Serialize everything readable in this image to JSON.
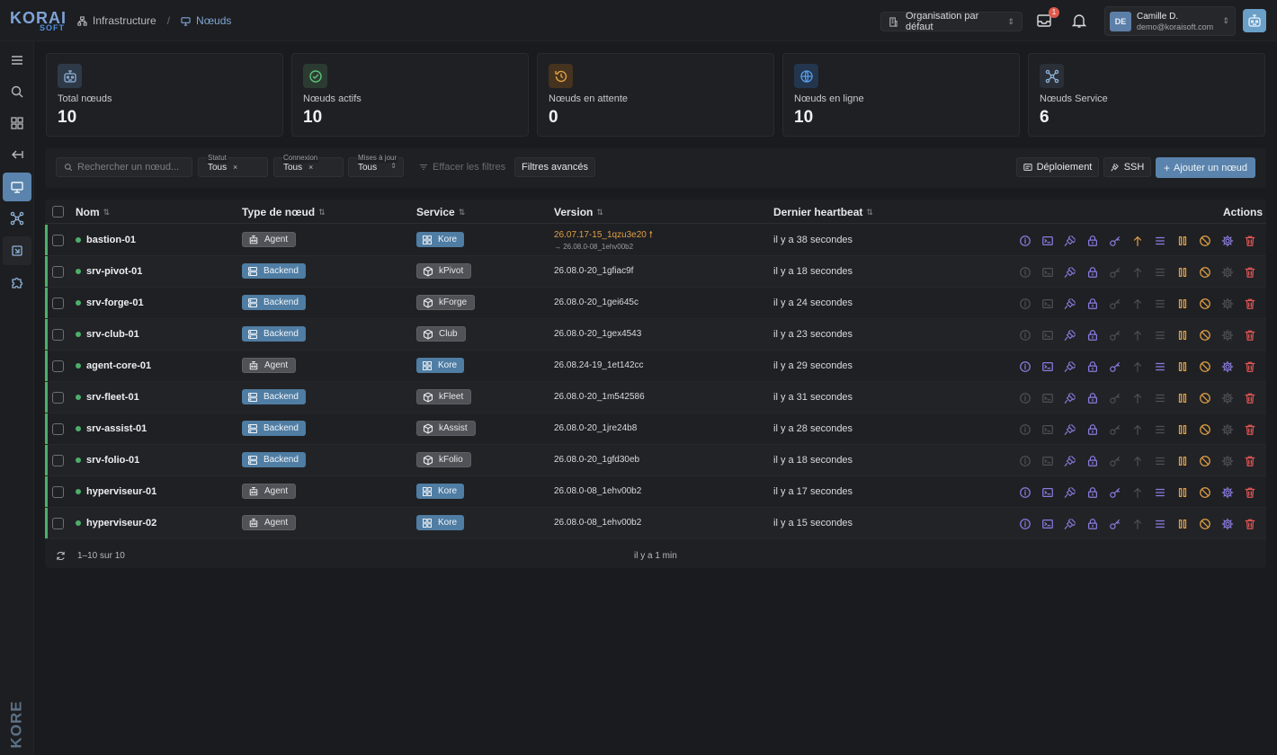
{
  "brand": {
    "logo_main": "KORAI",
    "logo_sub": "SOFT",
    "vertical_logo": "KORE"
  },
  "breadcrumb": {
    "parent": "Infrastructure",
    "current": "Nœuds"
  },
  "header": {
    "org_select": "Organisation par défaut",
    "inbox_badge": "1",
    "user": {
      "initials": "DE",
      "name": "Camille D.",
      "email": "demo@koraisoft.com"
    }
  },
  "sidebar": {
    "items": [
      {
        "icon": "menu-icon"
      },
      {
        "icon": "search-icon"
      },
      {
        "icon": "dashboard-grid-icon"
      },
      {
        "icon": "arrow-left-icon"
      },
      {
        "icon": "monitor-icon",
        "active": true
      },
      {
        "icon": "network-icon"
      },
      {
        "icon": "chip-icon"
      },
      {
        "icon": "puzzle-icon"
      }
    ]
  },
  "stats": [
    {
      "label": "Total nœuds",
      "value": "10",
      "icon": "robot-icon",
      "color": "#8fb3d9"
    },
    {
      "label": "Nœuds actifs",
      "value": "10",
      "icon": "check-circle-icon",
      "color": "#5cc17a"
    },
    {
      "label": "Nœuds en attente",
      "value": "0",
      "icon": "history-icon",
      "color": "#e0a046"
    },
    {
      "label": "Nœuds en ligne",
      "value": "10",
      "icon": "globe-icon",
      "color": "#5a9be6"
    },
    {
      "label": "Nœuds Service",
      "value": "6",
      "icon": "nodes-icon",
      "color": "#8fb3d9"
    }
  ],
  "toolbar": {
    "search_placeholder": "Rechercher un nœud...",
    "filters": [
      {
        "label": "Statut",
        "value": "Tous"
      },
      {
        "label": "Connexion",
        "value": "Tous"
      },
      {
        "label": "Mises à jour",
        "value": "Tous"
      }
    ],
    "clear_filters": "Effacer les filtres",
    "advanced_filters": "Filtres avancés",
    "deploy_label": "Déploiement",
    "ssh_label": "SSH",
    "add_label": "Ajouter un nœud"
  },
  "table": {
    "columns": [
      "Nom",
      "Type de nœud",
      "Service",
      "Version",
      "Dernier heartbeat",
      "Actions"
    ],
    "rows": [
      {
        "name": "bastion-01",
        "type": "Agent",
        "service": "Kore",
        "version": "26.07.17-15_1qzu3e20",
        "version_target": "→ 26.08.0-08_1ehv00b2",
        "update": true,
        "heartbeat": "il y a 38 secondes",
        "enabled": true
      },
      {
        "name": "srv-pivot-01",
        "type": "Backend",
        "service": "kPivot",
        "version": "26.08.0-20_1gfiac9f",
        "heartbeat": "il y a 18 secondes",
        "enabled": false
      },
      {
        "name": "srv-forge-01",
        "type": "Backend",
        "service": "kForge",
        "version": "26.08.0-20_1gei645c",
        "heartbeat": "il y a 24 secondes",
        "enabled": false
      },
      {
        "name": "srv-club-01",
        "type": "Backend",
        "service": "Club",
        "version": "26.08.0-20_1gex4543",
        "heartbeat": "il y a 23 secondes",
        "enabled": false
      },
      {
        "name": "agent-core-01",
        "type": "Agent",
        "service": "Kore",
        "version": "26.08.24-19_1et142cc",
        "heartbeat": "il y a 29 secondes",
        "enabled": true
      },
      {
        "name": "srv-fleet-01",
        "type": "Backend",
        "service": "kFleet",
        "version": "26.08.0-20_1m542586",
        "heartbeat": "il y a 31 secondes",
        "enabled": false
      },
      {
        "name": "srv-assist-01",
        "type": "Backend",
        "service": "kAssist",
        "version": "26.08.0-20_1jre24b8",
        "heartbeat": "il y a 28 secondes",
        "enabled": false
      },
      {
        "name": "srv-folio-01",
        "type": "Backend",
        "service": "kFolio",
        "version": "26.08.0-20_1gfd30eb",
        "heartbeat": "il y a 18 secondes",
        "enabled": false
      },
      {
        "name": "hyperviseur-01",
        "type": "Agent",
        "service": "Kore",
        "version": "26.08.0-08_1ehv00b2",
        "heartbeat": "il y a 17 secondes",
        "enabled": true
      },
      {
        "name": "hyperviseur-02",
        "type": "Agent",
        "service": "Kore",
        "version": "26.08.0-08_1ehv00b2",
        "heartbeat": "il y a 15 secondes",
        "enabled": true
      }
    ],
    "actions": [
      {
        "name": "info-icon",
        "color": "#8a7be0"
      },
      {
        "name": "terminal-icon",
        "color": "#8a7be0"
      },
      {
        "name": "plug-icon",
        "color": "#8a7be0"
      },
      {
        "name": "lock-icon",
        "color": "#8a7be0"
      },
      {
        "name": "key-icon",
        "color": "#8a7be0"
      },
      {
        "name": "arrow-up-icon",
        "color": "#e0a046"
      },
      {
        "name": "list-icon",
        "color": "#8a7be0"
      },
      {
        "name": "pause-icon",
        "color": "#e0a046"
      },
      {
        "name": "ban-icon",
        "color": "#e0a046"
      },
      {
        "name": "gear-icon",
        "color": "#8a7be0"
      },
      {
        "name": "trash-icon",
        "color": "#e05555"
      }
    ],
    "footer": {
      "count": "1–10 sur 10",
      "updated": "il y a 1 min"
    }
  },
  "colors": {
    "accent": "#5a84ad",
    "online": "#4caf6a",
    "warning": "#e0a046",
    "danger": "#e05555",
    "purple": "#8a7be0"
  }
}
